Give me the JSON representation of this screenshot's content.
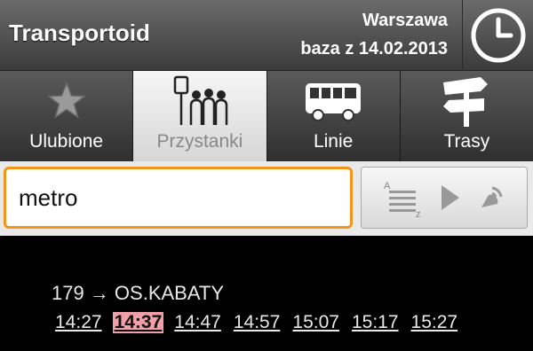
{
  "header": {
    "app_title": "Transportoid",
    "city": "Warszawa",
    "database_date": "baza z 14.02.2013",
    "clock_icon": "clock-icon"
  },
  "tabs": [
    {
      "label": "Ulubione",
      "icon": "star-icon",
      "active": false
    },
    {
      "label": "Przystanki",
      "icon": "bus-stop-icon",
      "active": true
    },
    {
      "label": "Linie",
      "icon": "bus-icon",
      "active": false
    },
    {
      "label": "Trasy",
      "icon": "signpost-icon",
      "active": false
    }
  ],
  "search": {
    "value": "metro"
  },
  "actions": {
    "icons": [
      "sort-az-icon",
      "play-icon",
      "gps-icon"
    ]
  },
  "result": {
    "route": "179 → OS.KABATY",
    "departures": [
      "14:27",
      "14:37",
      "14:47",
      "14:57",
      "15:07",
      "15:17",
      "15:27"
    ],
    "highlighted_index": 1
  },
  "colors": {
    "search_border": "#f39519",
    "highlight": "#f0a0a8"
  }
}
